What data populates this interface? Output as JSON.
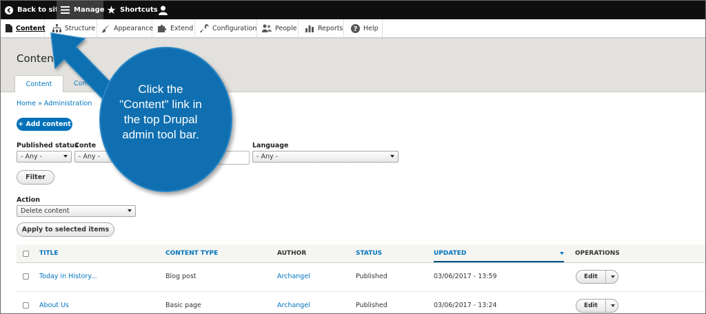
{
  "topbar": {
    "back_to_site": "Back to site",
    "manage": "Manage",
    "shortcuts": "Shortcuts"
  },
  "tray": {
    "items": [
      {
        "label": "Content",
        "icon": "file-icon"
      },
      {
        "label": "Structure",
        "icon": "sitemap-icon"
      },
      {
        "label": "Appearance",
        "icon": "brush-icon"
      },
      {
        "label": "Extend",
        "icon": "puzzle-icon"
      },
      {
        "label": "Configuration",
        "icon": "wrench-icon"
      },
      {
        "label": "People",
        "icon": "people-icon"
      },
      {
        "label": "Reports",
        "icon": "bar-chart-icon"
      },
      {
        "label": "Help",
        "icon": "help-icon"
      }
    ]
  },
  "page": {
    "title": "Conten",
    "tabs": [
      {
        "label": "Content"
      },
      {
        "label": "Comm"
      }
    ],
    "breadcrumb": "Home » Administration",
    "add_content": "+ Add content"
  },
  "filters": {
    "published_status_label": "Published status",
    "published_status_value": "- Any -",
    "content_type_label": "Conte",
    "content_type_value": "- Any -",
    "language_label": "Language",
    "language_value": "- Any -",
    "filter_button": "Filter"
  },
  "action": {
    "label": "Action",
    "value": "Delete content",
    "apply_button": "Apply to selected items"
  },
  "table": {
    "headers": {
      "title": "TITLE",
      "content_type": "CONTENT TYPE",
      "author": "AUTHOR",
      "status": "STATUS",
      "updated": "UPDATED",
      "operations": "OPERATIONS"
    },
    "rows": [
      {
        "title": "Today in History...",
        "content_type": "Blog post",
        "author": "Archangel",
        "status": "Published",
        "updated": "03/06/2017 - 13:59",
        "operation": "Edit"
      },
      {
        "title": "About Us",
        "content_type": "Basic page",
        "author": "Archangel",
        "status": "Published",
        "updated": "03/06/2017 - 13:24",
        "operation": "Edit"
      }
    ]
  },
  "callout": {
    "line1": "Click the",
    "line2": "\"Content\" link in",
    "line3": "the top Drupal",
    "line4": "admin tool bar.",
    "color": "#0f6fb0"
  },
  "colors": {
    "toolbar_black": "#0f0f0f",
    "link_blue": "#0074bd",
    "primary_button": "#0071b8",
    "header_gray": "#e2e1dd"
  }
}
